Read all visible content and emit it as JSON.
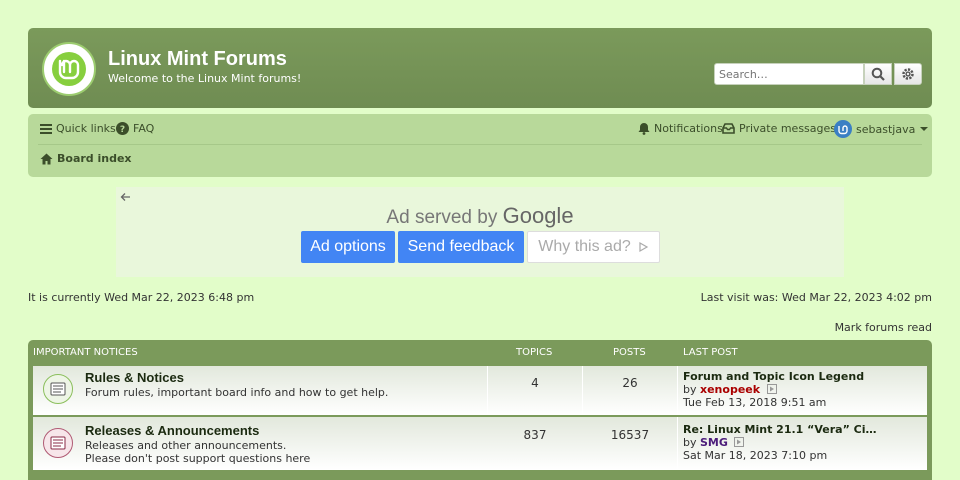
{
  "header": {
    "title": "Linux Mint Forums",
    "description": "Welcome to the Linux Mint forums!",
    "search_placeholder": "Search…"
  },
  "nav": {
    "quick_links": "Quick links",
    "faq": "FAQ",
    "notifications": "Notifications",
    "private_messages": "Private messages",
    "username": "sebastjava",
    "board_index": "Board index"
  },
  "ad": {
    "served_by": "Ad served by",
    "brand": "Google",
    "options": "Ad options",
    "feedback": "Send feedback",
    "why": "Why this ad?"
  },
  "status": {
    "current_time": "It is currently Wed Mar 22, 2023 6:48 pm",
    "last_visit": "Last visit was: Wed Mar 22, 2023 4:02 pm",
    "mark_read": "Mark forums read"
  },
  "forum_section": {
    "title": "IMPORTANT NOTICES",
    "col_topics": "TOPICS",
    "col_posts": "POSTS",
    "col_last_post": "LAST POST",
    "forums": [
      {
        "name": "Rules & Notices",
        "description": "Forum rules, important board info and how to get help.",
        "description2": "",
        "topics": "4",
        "posts": "26",
        "last_post_title": "Forum and Topic Icon Legend",
        "by_label": "by",
        "last_post_user": "xenopeek",
        "last_post_date": "Tue Feb 13, 2018 9:51 am"
      },
      {
        "name": "Releases & Announcements",
        "description": "Releases and other announcements.",
        "description2": "Please don't post support questions here",
        "topics": "837",
        "posts": "16537",
        "last_post_title": "Re: Linux Mint 21.1 “Vera” Ci…",
        "by_label": "by",
        "last_post_user": "SMG",
        "last_post_date": "Sat Mar 18, 2023 7:10 pm"
      }
    ]
  }
}
